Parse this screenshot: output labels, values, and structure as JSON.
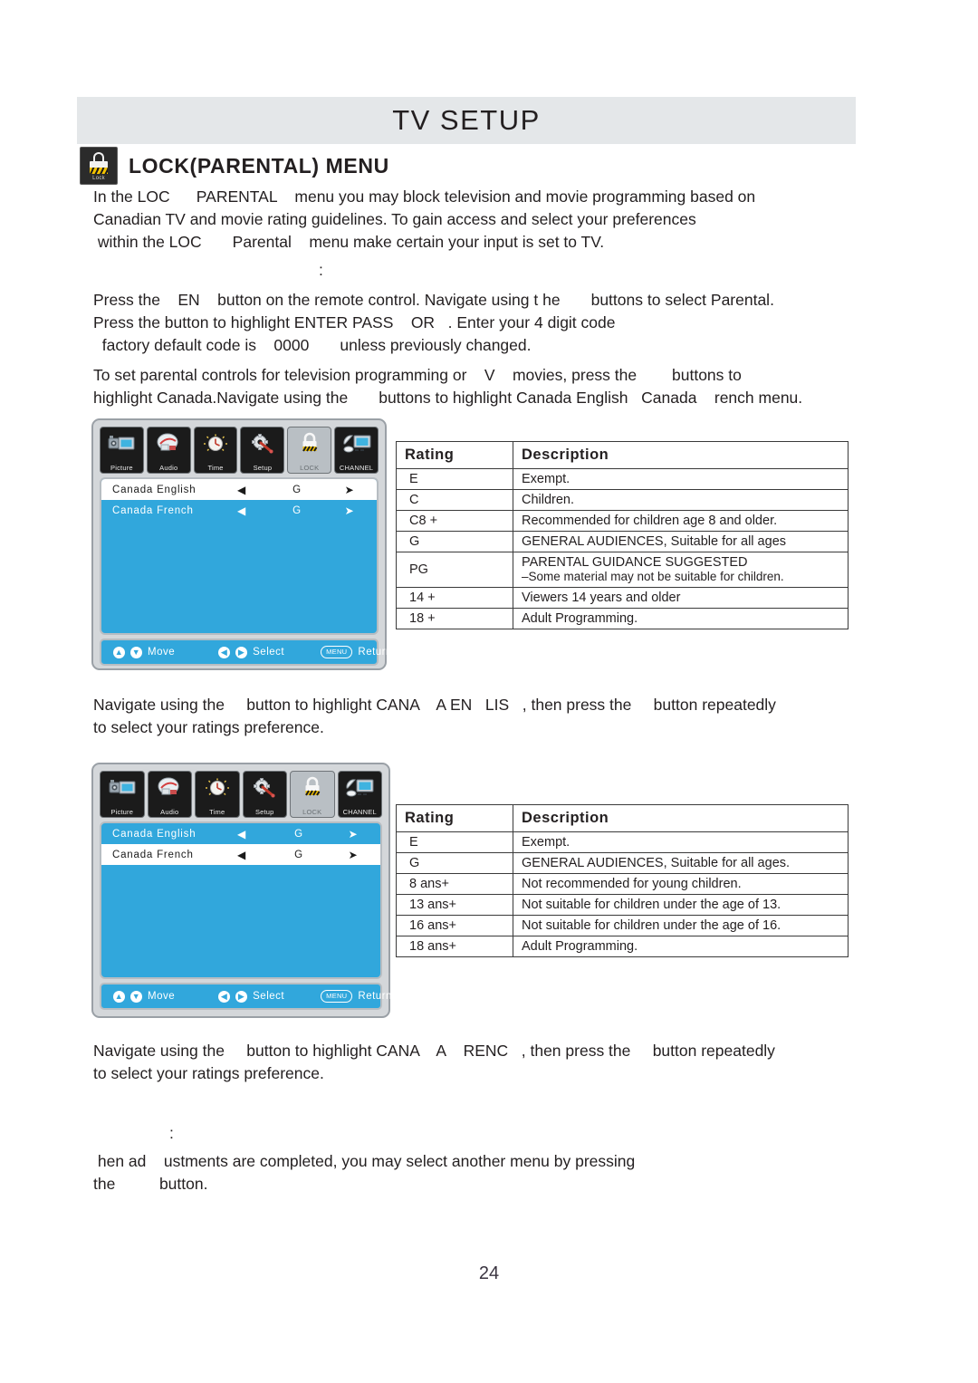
{
  "header": {
    "title": "TV SETUP"
  },
  "section": {
    "icon_caption": "Lock",
    "title": "LOCK(PARENTAL) MENU"
  },
  "paragraphs": {
    "intro": "In the LOC      PARENTAL    menu you may block television and movie programming based on\nCanadian TV and movie rating guidelines. To gain access and select your preferences\n within the LOC       Parental    menu make certain your input is set to TV.",
    "colon_mark": ":",
    "access": "Press the    EN    button on the remote control. Navigate using t he       buttons to select Parental.\nPress the button to highlight ENTER PASS    OR   . Enter your 4 digit code\n  factory default code is    0000       unless previously changed.",
    "set_controls": "To set parental controls for television programming or    V    movies, press the        buttons to\nhighlight Canada.Navigate using the       buttons to highlight Canada English   Canada    rench menu.",
    "nav_english": "Navigate using the     button to highlight CANA    A EN   LIS   , then press the     button repeatedly\nto select your ratings preference.",
    "nav_french": "Navigate using the     button to highlight CANA    A    RENC   , then press the     button repeatedly\nto select your ratings preference.",
    "colon_mark2": ":",
    "closing": " hen ad    ustments are completed, you may select another menu by pressing\nthe          button."
  },
  "osd": {
    "icons": [
      {
        "label": "Picture",
        "icon": "camera-monitor-icon"
      },
      {
        "label": "Audio",
        "icon": "audio-dish-icon"
      },
      {
        "label": "Time",
        "icon": "clock-icon"
      },
      {
        "label": "Setup",
        "icon": "gear-wand-icon"
      },
      {
        "label": "LOCK",
        "icon": "padlock-icon"
      },
      {
        "label": "CHANNEL",
        "icon": "satellite-monitor-icon"
      }
    ],
    "footer": {
      "move_label": "Move",
      "select_label": "Select",
      "return_label": "Return",
      "menu_button": "MENU",
      "up_arrow": "▲",
      "down_arrow": "▼",
      "left_arrow": "◀",
      "right_arrow": "▶"
    },
    "arrow_left": "◀",
    "arrow_right": "➤",
    "panel_one": {
      "rows": [
        {
          "name": "Canada English",
          "value": "G",
          "selected": true
        },
        {
          "name": "Canada French",
          "value": "G",
          "selected": false
        }
      ]
    },
    "panel_two": {
      "rows": [
        {
          "name": "Canada English",
          "value": "G",
          "selected": false
        },
        {
          "name": "Canada French",
          "value": "G",
          "selected": true
        }
      ]
    }
  },
  "tables": {
    "english": {
      "headers": [
        "Rating",
        "Description"
      ],
      "rows": [
        {
          "rating": "E",
          "desc": "Exempt."
        },
        {
          "rating": "C",
          "desc": "Children."
        },
        {
          "rating": "C8 +",
          "desc": "Recommended  for  children  age  8  and  older."
        },
        {
          "rating": "G",
          "desc": "GENERAL AUDIENCES, Suitable for all ages"
        },
        {
          "rating": "PG",
          "desc": "PARENTAL GUIDANCE SUGGESTED",
          "desc2": "–Some material may not be suitable for children."
        },
        {
          "rating": "14 +",
          "desc": "Viewers 14 years and older"
        },
        {
          "rating": "18 +",
          "desc": "Adult Programming."
        }
      ]
    },
    "french": {
      "headers": [
        "Rating",
        "Description"
      ],
      "rows": [
        {
          "rating": "E",
          "desc": "Exempt."
        },
        {
          "rating": "G",
          "desc": "GENERAL AUDIENCES, Suitable for all ages."
        },
        {
          "rating": "8 ans+",
          "desc": "Not  recommended  for  young  children."
        },
        {
          "rating": "13 ans+",
          "desc": "Not suitable for children under the age of 13."
        },
        {
          "rating": "16 ans+",
          "desc": "Not suitable for children under the age of 16."
        },
        {
          "rating": "18 ans+",
          "desc": "Adult Programming."
        }
      ]
    }
  },
  "footer": {
    "page_number": "24"
  },
  "colors": {
    "header_bar": "#e4e7e9",
    "osd_blue": "#31a7dc",
    "osd_frame": "#d4d7da"
  }
}
